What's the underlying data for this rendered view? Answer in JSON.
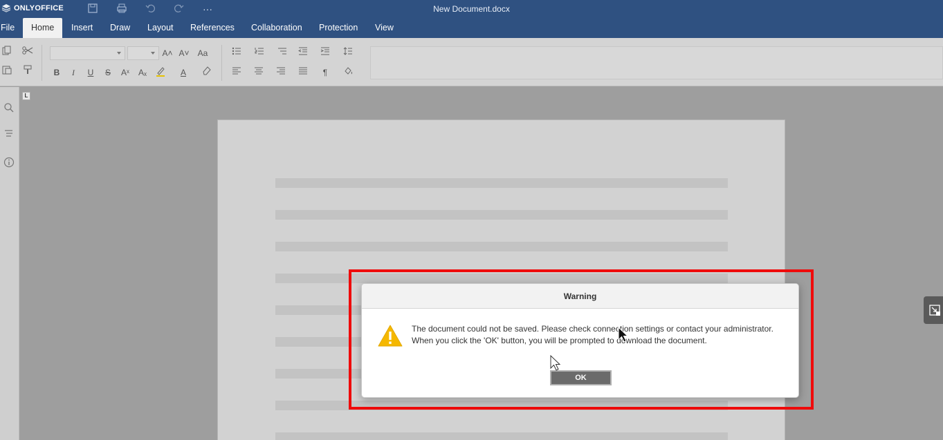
{
  "app": {
    "brand": "ONLYOFFICE",
    "document_title": "New Document.docx"
  },
  "titlebar_icons": [
    "save-icon",
    "print-icon",
    "undo-icon",
    "redo-icon",
    "more-icon"
  ],
  "tabs": [
    {
      "label": "File",
      "active": false
    },
    {
      "label": "Home",
      "active": true
    },
    {
      "label": "Insert",
      "active": false
    },
    {
      "label": "Draw",
      "active": false
    },
    {
      "label": "Layout",
      "active": false
    },
    {
      "label": "References",
      "active": false
    },
    {
      "label": "Collaboration",
      "active": false
    },
    {
      "label": "Protection",
      "active": false
    },
    {
      "label": "View",
      "active": false
    }
  ],
  "toolbar": {
    "bold": "B",
    "italic": "I",
    "underline": "U",
    "strike": "S",
    "superscript": "Aˣ",
    "subscript": "Aₓ",
    "font_color": "A",
    "increase_font": "A˄",
    "decrease_font": "A˅",
    "change_case": "Aa",
    "paragraph_mark": "¶"
  },
  "ruler_corner": "L",
  "dialog": {
    "title": "Warning",
    "message_line1": "The document could not be saved. Please check connection settings or contact your administrator.",
    "message_line2": "When you click the 'OK' button, you will be prompted to download the document.",
    "ok_label": "OK"
  },
  "colors": {
    "header": "#2f5181",
    "highlight": "#ef0b0b",
    "warning_icon": "#f5b800"
  }
}
